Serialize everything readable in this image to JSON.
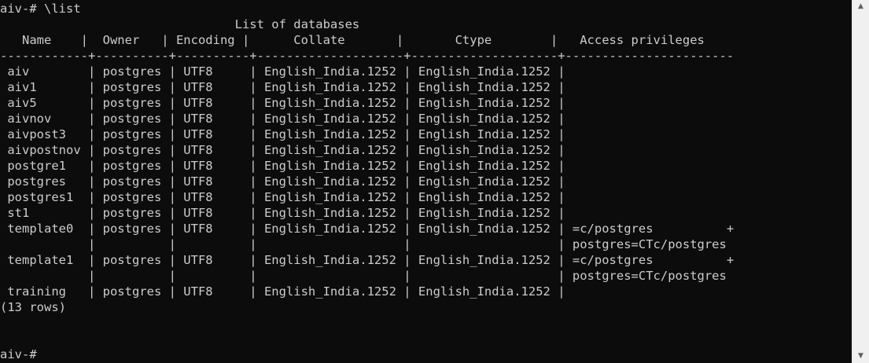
{
  "terminal": {
    "lines": [
      "aiv-# \\list",
      "                                List of databases",
      "   Name    |  Owner   | Encoding |      Collate       |       Ctype        |   Access privileges",
      "------------+----------+----------+--------------------+--------------------+-----------------------",
      " aiv        | postgres | UTF8     | English_India.1252 | English_India.1252 |",
      " aiv1       | postgres | UTF8     | English_India.1252 | English_India.1252 |",
      " aiv5       | postgres | UTF8     | English_India.1252 | English_India.1252 |",
      " aivnov     | postgres | UTF8     | English_India.1252 | English_India.1252 |",
      " aivpost3   | postgres | UTF8     | English_India.1252 | English_India.1252 |",
      " aivpostnov | postgres | UTF8     | English_India.1252 | English_India.1252 |",
      " postgre1   | postgres | UTF8     | English_India.1252 | English_India.1252 |",
      " postgres   | postgres | UTF8     | English_India.1252 | English_India.1252 |",
      " postgres1  | postgres | UTF8     | English_India.1252 | English_India.1252 |",
      " st1        | postgres | UTF8     | English_India.1252 | English_India.1252 |",
      " template0  | postgres | UTF8     | English_India.1252 | English_India.1252 | =c/postgres          +",
      "            |          |          |                    |                    | postgres=CTc/postgres",
      " template1  | postgres | UTF8     | English_India.1252 | English_India.1252 | =c/postgres          +",
      "            |          |          |                    |                    | postgres=CTc/postgres",
      " training   | postgres | UTF8     | English_India.1252 | English_India.1252 |",
      "(13 rows)",
      "",
      "",
      "aiv-#"
    ]
  },
  "scrollbar": {
    "up_glyph": "▲",
    "down_glyph": "▼"
  }
}
